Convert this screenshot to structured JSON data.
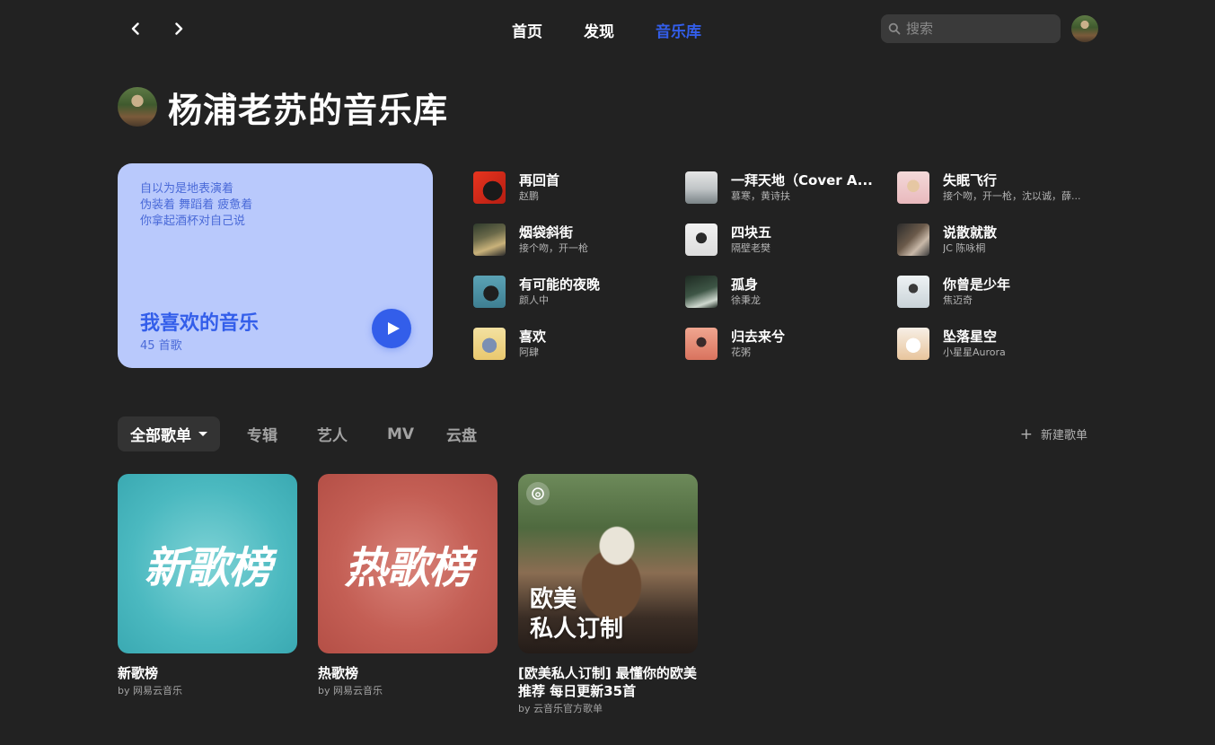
{
  "nav": {
    "back_icon": "chevron-left-icon",
    "forward_icon": "chevron-right-icon",
    "tabs": [
      {
        "label": "首页",
        "active": false
      },
      {
        "label": "发现",
        "active": false
      },
      {
        "label": "音乐库",
        "active": true
      }
    ],
    "search_placeholder": "搜索",
    "accent_color": "#335eea"
  },
  "header": {
    "title": "杨浦老苏的音乐库"
  },
  "liked": {
    "lyrics": [
      "自以为是地表演着",
      "伪装着 舞蹈着 疲惫着",
      "你拿起酒杯对自己说"
    ],
    "title": "我喜欢的音乐",
    "count": "45 首歌",
    "card_color": "#b9c9fc"
  },
  "songs": [
    {
      "title": "再回首",
      "artist": "赵鹏"
    },
    {
      "title": "一拜天地（Cover A...",
      "artist": "慕寒，黄诗扶"
    },
    {
      "title": "失眠飞行",
      "artist": "接个吻，开一枪，沈以诚，薛..."
    },
    {
      "title": "烟袋斜街",
      "artist": "接个吻，开一枪"
    },
    {
      "title": "四块五",
      "artist": "隔壁老樊"
    },
    {
      "title": "说散就散",
      "artist": "JC 陈咏桐"
    },
    {
      "title": "有可能的夜晚",
      "artist": "颜人中"
    },
    {
      "title": "孤身",
      "artist": "徐秉龙"
    },
    {
      "title": "你曾是少年",
      "artist": "焦迈奇"
    },
    {
      "title": "喜欢",
      "artist": "阿肆"
    },
    {
      "title": "归去来兮",
      "artist": "花粥"
    },
    {
      "title": "坠落星空",
      "artist": "小星星Aurora"
    }
  ],
  "tabs": {
    "items": [
      {
        "label": "全部歌单",
        "active": true
      },
      {
        "label": "专辑",
        "active": false
      },
      {
        "label": "艺人",
        "active": false
      },
      {
        "label": "MV",
        "active": false
      },
      {
        "label": "云盘",
        "active": false
      }
    ],
    "new_playlist": "新建歌单"
  },
  "playlists": [
    {
      "cover_text": "新歌榜",
      "title": "新歌榜",
      "by": "by 网易云音乐"
    },
    {
      "cover_text": "热歌榜",
      "title": "热歌榜",
      "by": "by 网易云音乐"
    },
    {
      "cover_text_line1": "欧美",
      "cover_text_line2": "私人订制",
      "title": "[欧美私人订制] 最懂你的欧美推荐 每日更新35首",
      "by": "by 云音乐官方歌单"
    }
  ]
}
